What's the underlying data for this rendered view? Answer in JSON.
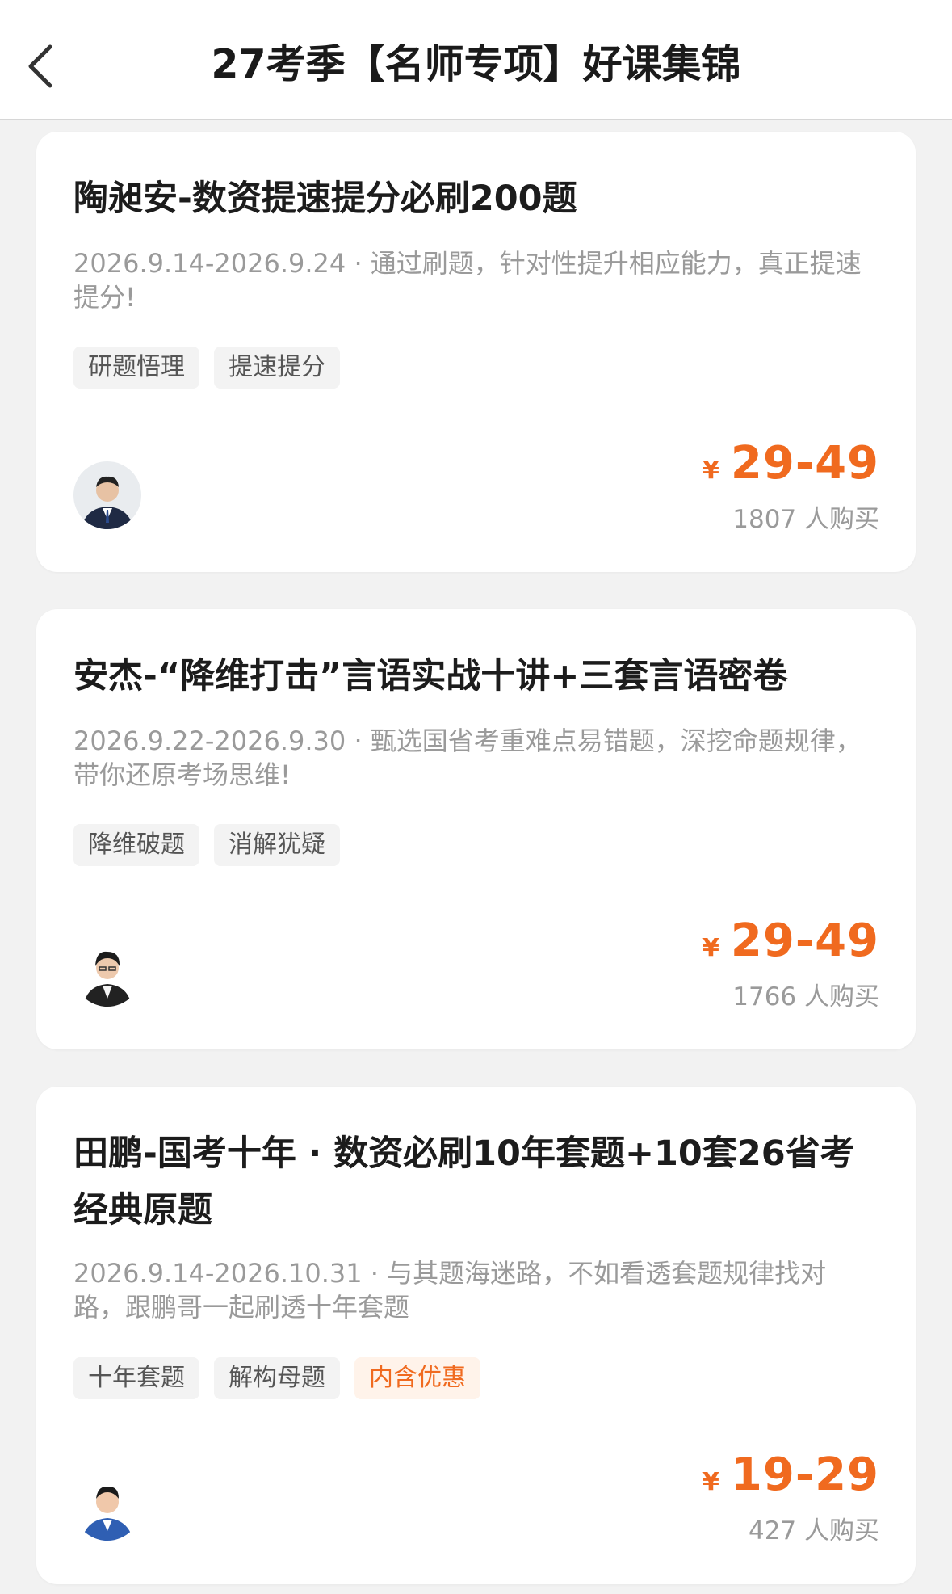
{
  "header": {
    "title": "27考季【名师专项】好课集锦",
    "back_icon": "chevron-left-icon"
  },
  "colors": {
    "accent": "#f06a1f",
    "background": "#f2f2f2"
  },
  "courses": [
    {
      "title": "陶昶安-数资提速提分必刷200题",
      "description": "2026.9.14-2026.9.24 · 通过刷题，针对性提升相应能力，真正提速提分!",
      "tags": [
        "研题悟理",
        "提速提分"
      ],
      "currency": "¥",
      "price": "29-49",
      "buyers": "1807 人购买"
    },
    {
      "title": "安杰-“降维打击”言语实战十讲+三套言语密卷",
      "description": "2026.9.22-2026.9.30 · 甄选国省考重难点易错题，深挖命题规律，带你还原考场思维!",
      "tags": [
        "降维破题",
        "消解犹疑"
      ],
      "currency": "¥",
      "price": "29-49",
      "buyers": "1766 人购买"
    },
    {
      "title": "田鹏-国考十年 · 数资必刷10年套题+10套26省考经典原题",
      "description": "2026.9.14-2026.10.31 · 与其题海迷路，不如看透套题规律找对路，跟鹏哥一起刷透十年套题",
      "tags": [
        "十年套题",
        "解构母题",
        "内含优惠"
      ],
      "currency": "¥",
      "price": "19-29",
      "buyers": "427 人购买"
    }
  ]
}
